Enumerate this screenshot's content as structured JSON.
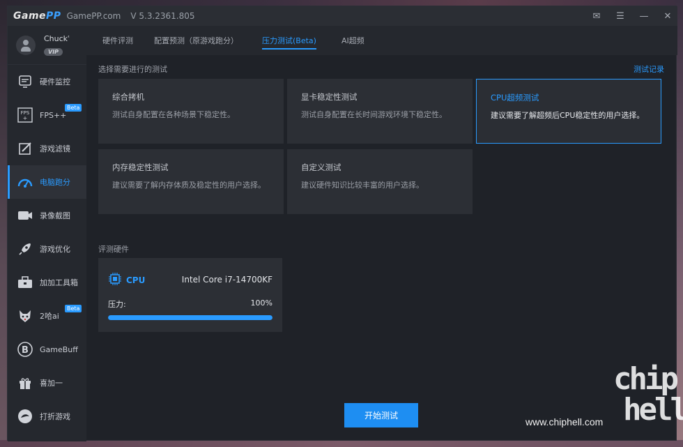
{
  "titlebar": {
    "logo_main": "Game",
    "logo_accent": "PP",
    "site": "GamePP.com",
    "version": "V 5.3.2361.805"
  },
  "user": {
    "name": "Chuckʿ",
    "badge": "VIP"
  },
  "sidebar": {
    "items": [
      {
        "label": "硬件监控",
        "icon": "monitor-icon"
      },
      {
        "label": "FPS++",
        "icon": "fps-icon",
        "tag": "Beta"
      },
      {
        "label": "游戏滤镜",
        "icon": "filter-icon"
      },
      {
        "label": "电脑跑分",
        "icon": "gauge-icon",
        "active": true
      },
      {
        "label": "录像截图",
        "icon": "camera-icon"
      },
      {
        "label": "游戏优化",
        "icon": "rocket-icon"
      },
      {
        "label": "加加工具箱",
        "icon": "toolbox-icon"
      },
      {
        "label": "2哈ai",
        "icon": "husky-icon",
        "tag": "Beta"
      },
      {
        "label": "GameBuff",
        "icon": "gamebuff-icon"
      },
      {
        "label": "喜加一",
        "icon": "gift-icon"
      },
      {
        "label": "打折游戏",
        "icon": "sale-icon"
      }
    ]
  },
  "tabs": [
    {
      "label": "硬件评测"
    },
    {
      "label": "配置预测（原游戏跑分）"
    },
    {
      "label": "压力测试(Beta)",
      "active": true
    },
    {
      "label": "AI超频"
    }
  ],
  "main": {
    "select_label": "选择需要进行的测试",
    "record_link": "测试记录",
    "cards": [
      {
        "title": "综合拷机",
        "desc": "测试自身配置在各种场景下稳定性。"
      },
      {
        "title": "显卡稳定性测试",
        "desc": "测试自身配置在长时间游戏环境下稳定性。"
      },
      {
        "title": "CPU超频测试",
        "desc": "建议需要了解超频后CPU稳定性的用户选择。",
        "selected": true
      },
      {
        "title": "内存稳定性测试",
        "desc": "建议需要了解内存体质及稳定性的用户选择。"
      },
      {
        "title": "自定义测试",
        "desc": "建议硬件知识比较丰富的用户选择。"
      }
    ],
    "hardware_label": "评测硬件",
    "hardware": {
      "type": "CPU",
      "model": "Intel Core i7-14700KF",
      "load_label": "压力:",
      "load_value": "100%",
      "load_fraction": 1.0
    },
    "start_button": "开始测试"
  },
  "watermark": {
    "site": "www.chiphell.com",
    "logo_top": "chip",
    "logo_bottom": "hell"
  },
  "colors": {
    "accent": "#2a9bff",
    "window_bg": "#1f2228",
    "card_bg": "#2c2f35"
  }
}
